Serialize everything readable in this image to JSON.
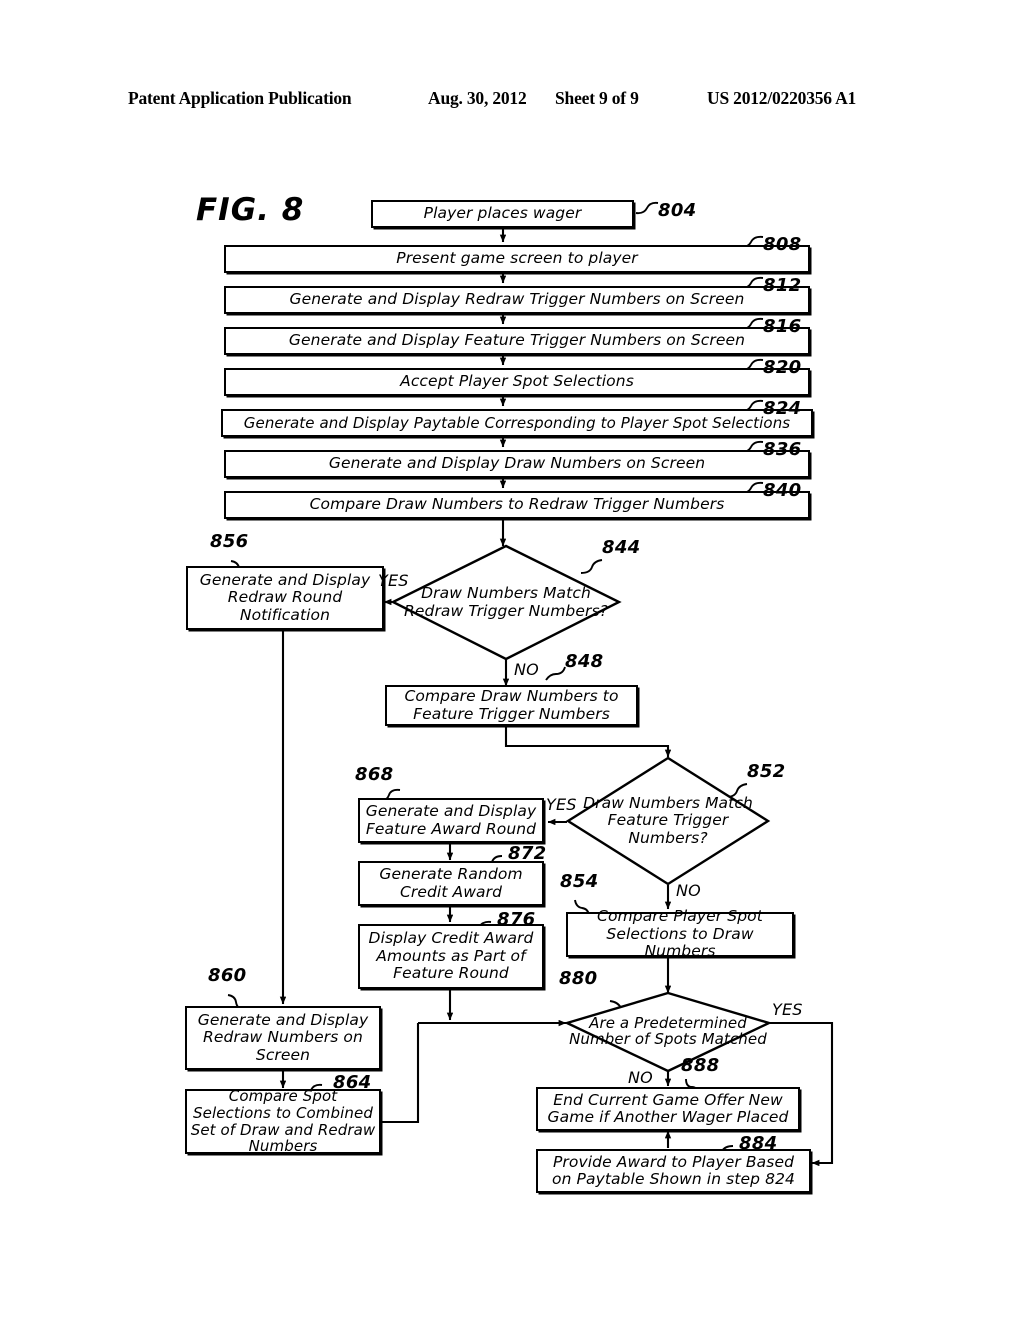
{
  "header": {
    "publication": "Patent Application Publication",
    "date": "Aug. 30, 2012",
    "sheet": "Sheet 9 of 9",
    "number": "US 2012/0220356 A1"
  },
  "figure": {
    "label": "FIG. 8"
  },
  "nodes": {
    "n804": {
      "ref": "804",
      "text": "Player places wager"
    },
    "n808": {
      "ref": "808",
      "text": "Present game screen to player"
    },
    "n812": {
      "ref": "812",
      "text": "Generate and Display Redraw Trigger Numbers on Screen"
    },
    "n816": {
      "ref": "816",
      "text": "Generate and Display Feature Trigger Numbers on Screen"
    },
    "n820": {
      "ref": "820",
      "text": "Accept Player Spot Selections"
    },
    "n824": {
      "ref": "824",
      "text": "Generate and Display Paytable Corresponding to Player Spot Selections"
    },
    "n836": {
      "ref": "836",
      "text": "Generate and Display Draw Numbers on Screen"
    },
    "n840": {
      "ref": "840",
      "text": "Compare Draw Numbers to Redraw Trigger Numbers"
    },
    "n844": {
      "ref": "844",
      "text": "Draw Numbers Match Redraw Trigger Numbers?"
    },
    "n848": {
      "ref": "848",
      "text": "Compare Draw Numbers to Feature Trigger Numbers"
    },
    "n852": {
      "ref": "852",
      "text": "Draw Numbers Match Feature Trigger Numbers?"
    },
    "n854": {
      "ref": "854",
      "text": "Compare Player Spot Selections to Draw Numbers"
    },
    "n856": {
      "ref": "856",
      "text": "Generate and Display Redraw Round Notification"
    },
    "n860": {
      "ref": "860",
      "text": "Generate and Display Redraw Numbers on Screen"
    },
    "n864": {
      "ref": "864",
      "text": "Compare Spot Selections to Combined Set of Draw and Redraw Numbers"
    },
    "n868": {
      "ref": "868",
      "text": "Generate and Display Feature Award Round"
    },
    "n872": {
      "ref": "872",
      "text": "Generate Random Credit Award"
    },
    "n876": {
      "ref": "876",
      "text": "Display Credit Award Amounts as Part of Feature Round"
    },
    "n880": {
      "ref": "880",
      "text": "Are a Predetermined Number of Spots Matched"
    },
    "n884": {
      "ref": "884",
      "text": "Provide Award to Player Based on Paytable Shown in step 824"
    },
    "n888": {
      "ref": "888",
      "text": "End Current Game Offer New Game if Another Wager Placed"
    }
  },
  "branches": {
    "b844_yes": "YES",
    "b844_no": "NO",
    "b852_yes": "YES",
    "b852_no": "NO",
    "b880_yes": "YES",
    "b880_no": "NO"
  },
  "colors": {
    "ink": "#000000",
    "paper": "#ffffff"
  }
}
